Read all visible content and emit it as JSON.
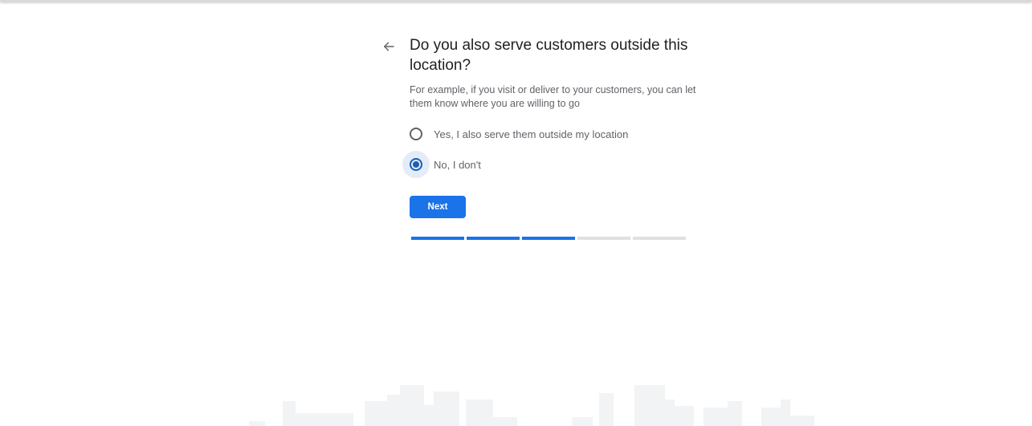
{
  "page": {
    "title": "Do you also serve customers outside this location?",
    "subtitle": "For example, if you visit or deliver to your customers, you can let them know where you are willing to go"
  },
  "icons": {
    "back": "arrow-back-icon"
  },
  "options": [
    {
      "label": "Yes, I also serve them outside my location",
      "selected": false
    },
    {
      "label": "No, I don't",
      "selected": true
    }
  ],
  "actions": {
    "next_label": "Next"
  },
  "progress": {
    "completed_steps": 3,
    "total_steps": 5
  },
  "colors": {
    "accent": "#1a73e8",
    "radio_selected": "#1a5fb4",
    "text_primary": "#202124",
    "text_secondary": "#5f6368",
    "progress_inactive": "#e0e0e0"
  }
}
